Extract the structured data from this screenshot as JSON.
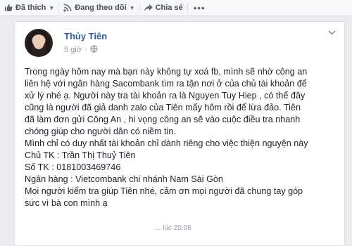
{
  "toolbar": {
    "liked_label": "Đã thích",
    "following_label": "Đang theo dõi",
    "share_label": "Chia sẻ",
    "more_label": "•••"
  },
  "post": {
    "author": "Thủy Tiên",
    "time": "5 giờ",
    "lines": [
      "Trong ngày hôm nay mà bạn này không tự xoá fb, mình sẽ nhờ công an",
      "liên hệ với ngân hàng Sacombank tìm ra tận nơi ở của chủ tài khoản để",
      "xử lý nhé ạ. Người này tra tài khoản ra là Nguyen Tuy Hiep , có thể đây",
      "cũng là người đã giả danh zalo của Tiên mấy hôm rồi để lừa đảo. Tiên",
      "đã làm đơn gửi Công An , hi vọng công an sẽ vào cuộc điều tra nhanh",
      "chóng giúp cho người dân có niềm tin.",
      "Mình chỉ có duy nhất tài khoản chỉ dành riêng cho việc thiện nguyện này",
      "Chủ TK : Trần Thị Thuỷ Tiên",
      "Số TK : 0181003469746",
      "Ngân hàng : Vietcombank chi nhánh Nam Sài Gòn",
      "Mọi người kiểm tra giúp Tiên nhé, cảm ơn mọi người đã chung tay góp",
      "sức vì bà con mình ạ"
    ],
    "footer_peek": "... lúc 20:06"
  },
  "colors": {
    "link": "#365899",
    "text": "#1d2129",
    "muted": "#90949c",
    "background": "#e9ebee"
  }
}
